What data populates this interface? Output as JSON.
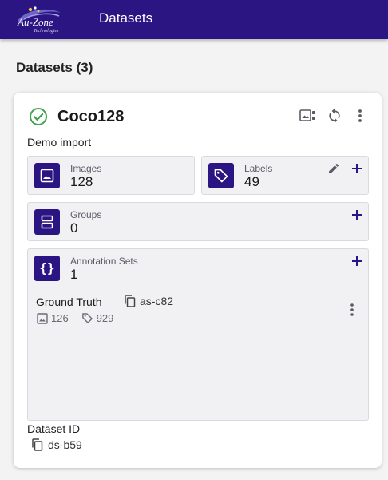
{
  "header": {
    "logo_text": "Au-Zone",
    "logo_subtext": "Technologies",
    "title": "Datasets"
  },
  "page": {
    "heading": "Datasets (3)"
  },
  "dataset": {
    "name": "Coco128",
    "status": "ready",
    "description": "Demo import",
    "stats": {
      "images": {
        "label": "Images",
        "value": "128"
      },
      "labels": {
        "label": "Labels",
        "value": "49"
      },
      "groups": {
        "label": "Groups",
        "value": "0"
      },
      "annotation_sets": {
        "label": "Annotation Sets",
        "value": "1"
      }
    },
    "annotation_set": {
      "name": "Ground Truth",
      "id": "as-c82",
      "image_count": "126",
      "label_count": "929"
    },
    "id_label": "Dataset ID",
    "id": "ds-b59"
  },
  "colors": {
    "brand": "#2a1583",
    "success": "#3fa14d",
    "icon_gray": "#5a5a64"
  }
}
